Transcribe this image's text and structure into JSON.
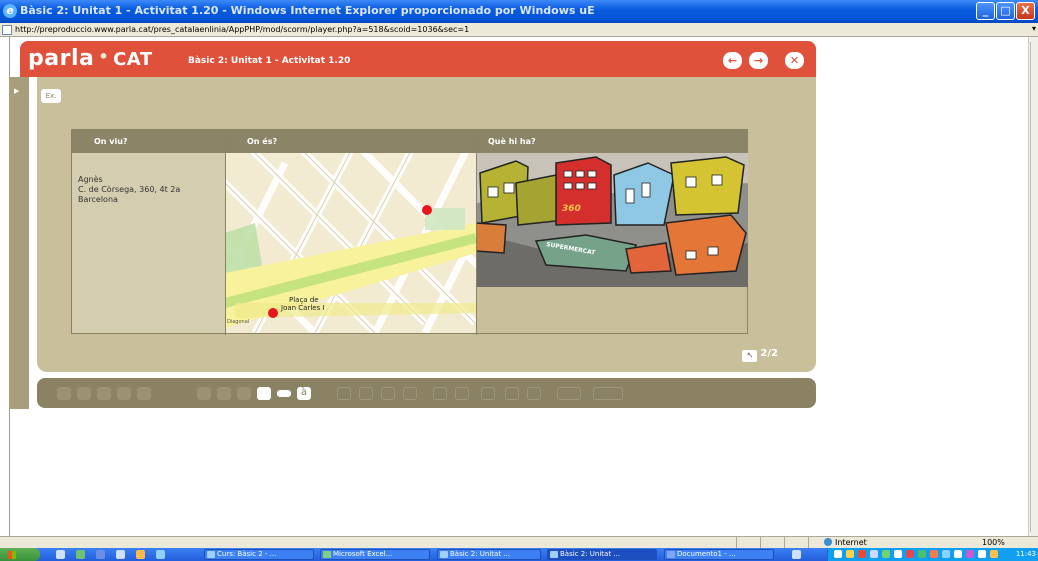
{
  "window": {
    "title": "Bàsic 2: Unitat 1 - Activitat 1.20 - Windows Internet Explorer proporcionado por Windows uE",
    "buttons": {
      "minimize": "_",
      "maximize": "□",
      "close": "X"
    }
  },
  "address_bar": {
    "url": "http://preproduccio.www.parla.cat/pres_catalaenlinia/AppPHP/mod/scorm/player.php?a=518&scoid=1036&sec=1"
  },
  "header": {
    "brand_main": "parla",
    "brand_dot": "•",
    "brand_cat": "CAT",
    "title": "Bàsic 2: Unitat 1 - Activitat 1.20",
    "prev_label": "←",
    "next_label": "→",
    "close_label": "✕"
  },
  "activity": {
    "ex_label": "Ex.",
    "columns": [
      "On viu?",
      "On és?",
      "Què hi ha?"
    ],
    "person": {
      "name": "Agnès",
      "address_line": "C. de Còrsega, 360, 4t 2a",
      "city": "Barcelona"
    },
    "map_labels": [
      "Plaça de",
      "Joan Carles I",
      "Diagonal"
    ],
    "building_number": "360",
    "market_label": "SUPERMERCAT",
    "pager": "2/2",
    "pager_icon": "↖"
  },
  "toolbar": {
    "accent_icon_label": "à"
  },
  "statusbar": {
    "zone": "Internet",
    "zoom": "100%"
  },
  "taskbar": {
    "tasks": [
      {
        "label": "Curs: Bàsic 2 - ..."
      },
      {
        "label": "Microsoft Excel..."
      },
      {
        "label": "Bàsic 2: Unitat ..."
      },
      {
        "label": "Bàsic 2: Unitat ..."
      },
      {
        "label": "Documento1 - ..."
      }
    ],
    "clock": "11:43"
  }
}
